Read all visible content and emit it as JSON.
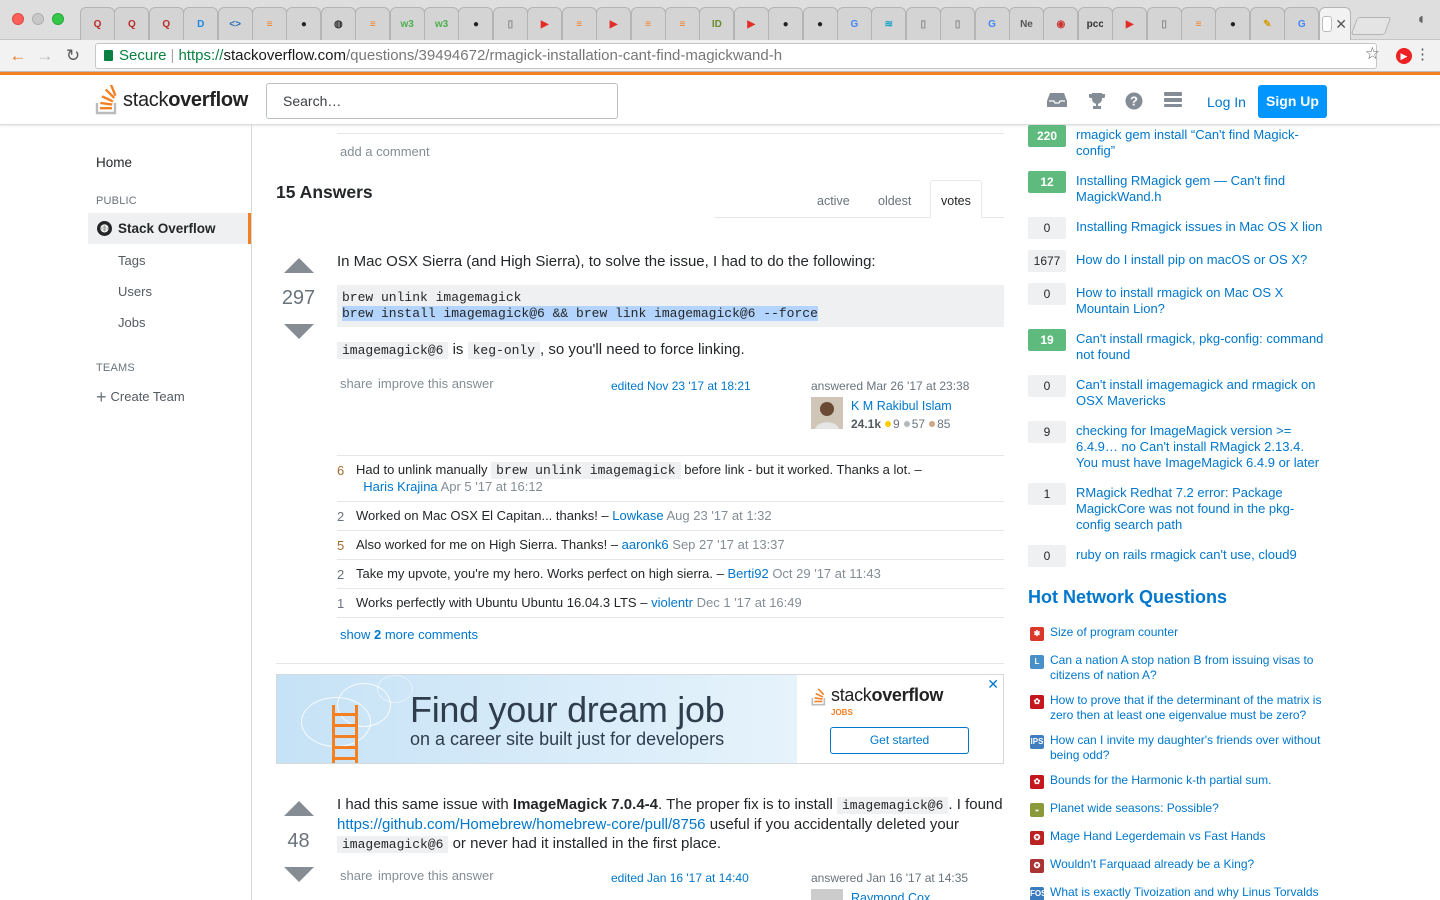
{
  "browser": {
    "tabs": [
      {
        "icon": "quora-icon",
        "glyph": "Q",
        "color": "#b92b27"
      },
      {
        "icon": "quora-icon",
        "glyph": "Q",
        "color": "#b92b27"
      },
      {
        "icon": "quora-icon",
        "glyph": "Q",
        "color": "#b92b27"
      },
      {
        "icon": "d-icon",
        "glyph": "D",
        "color": "#1e88e5"
      },
      {
        "icon": "code-icon",
        "glyph": "<>",
        "color": "#2a6db5"
      },
      {
        "icon": "stackoverflow-icon",
        "glyph": "≡",
        "color": "#f48024"
      },
      {
        "icon": "github-icon",
        "glyph": "●",
        "color": "#222"
      },
      {
        "icon": "globe-icon",
        "glyph": "◍",
        "color": "#333"
      },
      {
        "icon": "stackoverflow-icon",
        "glyph": "≡",
        "color": "#f48024"
      },
      {
        "icon": "w3-icon",
        "glyph": "w3",
        "color": "#4caf50"
      },
      {
        "icon": "w3-icon",
        "glyph": "w3",
        "color": "#4caf50"
      },
      {
        "icon": "github-icon",
        "glyph": "●",
        "color": "#222"
      },
      {
        "icon": "document-icon",
        "glyph": "▯",
        "color": "#888"
      },
      {
        "icon": "youtube-icon",
        "glyph": "▶",
        "color": "#e52d27"
      },
      {
        "icon": "stackoverflow-icon",
        "glyph": "≡",
        "color": "#f48024"
      },
      {
        "icon": "youtube-icon",
        "glyph": "▶",
        "color": "#e52d27"
      },
      {
        "icon": "stackoverflow-icon",
        "glyph": "≡",
        "color": "#f48024"
      },
      {
        "icon": "stackoverflow-icon",
        "glyph": "≡",
        "color": "#f48024"
      },
      {
        "icon": "id-icon",
        "glyph": "ID",
        "color": "#6a8b2f"
      },
      {
        "icon": "youtube-icon",
        "glyph": "▶",
        "color": "#e52d27"
      },
      {
        "icon": "github-icon",
        "glyph": "●",
        "color": "#222"
      },
      {
        "icon": "github-icon",
        "glyph": "●",
        "color": "#222"
      },
      {
        "icon": "google-icon",
        "glyph": "G",
        "color": "#4285f4"
      },
      {
        "icon": "wifi-icon",
        "glyph": "≋",
        "color": "#1aa3c8"
      },
      {
        "icon": "document-icon",
        "glyph": "▯",
        "color": "#888"
      },
      {
        "icon": "document-icon",
        "glyph": "▯",
        "color": "#888"
      },
      {
        "icon": "google-icon",
        "glyph": "G",
        "color": "#4285f4"
      },
      {
        "icon": "ne-icon",
        "glyph": "Ne",
        "color": "#555"
      },
      {
        "icon": "badge-icon",
        "glyph": "◉",
        "color": "#c33"
      },
      {
        "icon": "pcc-icon",
        "glyph": "pcc",
        "color": "#333"
      },
      {
        "icon": "youtube-icon",
        "glyph": "▶",
        "color": "#e52d27"
      },
      {
        "icon": "document-icon",
        "glyph": "▯",
        "color": "#888"
      },
      {
        "icon": "stackoverflow-icon",
        "glyph": "≡",
        "color": "#f48024"
      },
      {
        "icon": "github-icon",
        "glyph": "●",
        "color": "#222"
      },
      {
        "icon": "pencil-icon",
        "glyph": "✎",
        "color": "#d4a017"
      },
      {
        "icon": "google-icon",
        "glyph": "G",
        "color": "#4285f4"
      }
    ],
    "active_tab_close": "✕",
    "secure_label": "Secure",
    "url_https": "https://",
    "url_host": "stackoverflow.com",
    "url_path": "/questions/39494672/rmagick-installation-cant-find-magickwand-h"
  },
  "site": {
    "logo_stack": "stack",
    "logo_overflow": "overflow",
    "search_placeholder": "Search…",
    "login": "Log In",
    "signup": "Sign Up"
  },
  "nav": {
    "home": "Home",
    "public": "PUBLIC",
    "stackoverflow": "Stack Overflow",
    "tags": "Tags",
    "users": "Users",
    "jobs": "Jobs",
    "teams": "TEAMS",
    "create_team": "Create Team"
  },
  "question": {
    "add_comment": "add a comment",
    "answers_count": "15 Answers",
    "sort": {
      "active": "active",
      "oldest": "oldest",
      "votes": "votes"
    }
  },
  "answer1": {
    "votes": "297",
    "intro": "In Mac OSX Sierra (and High Sierra), to solve the issue, I had to do the following:",
    "code_line1": "brew unlink imagemagick",
    "code_line2": "brew install imagemagick@6 && brew link imagemagick@6 --force",
    "note_code1": "imagemagick@6",
    "note_is": "is",
    "note_code2": "keg-only",
    "note_rest": ", so you'll need to force linking.",
    "share": "share",
    "improve": "improve this answer",
    "edited": "edited Nov 23 '17 at 18:21",
    "answered": "answered Mar 26 '17 at 23:38",
    "user": "K M Rakibul Islam",
    "rep": "24.1k",
    "gold": "9",
    "silver": "57",
    "bronze": "85",
    "comments": [
      {
        "score": "6",
        "hot": true,
        "text_before": "Had to unlink manually",
        "code": "brew unlink imagemagick",
        "text_after": "before link - but it worked. Thanks a lot. –",
        "user": "Haris Krajina",
        "date": "Apr 5 '17 at 16:12"
      },
      {
        "score": "2",
        "hot": false,
        "text_before": "Worked on Mac OSX El Capitan... thanks! –",
        "code": "",
        "text_after": "",
        "user": "Lowkase",
        "date": "Aug 23 '17 at 1:32"
      },
      {
        "score": "5",
        "hot": true,
        "text_before": "Also worked for me on High Sierra. Thanks! –",
        "code": "",
        "text_after": "",
        "user": "aaronk6",
        "date": "Sep 27 '17 at 13:37"
      },
      {
        "score": "2",
        "hot": false,
        "text_before": "Take my upvote, you're my hero. Works perfect on high sierra. –",
        "code": "",
        "text_after": "",
        "user": "Berti92",
        "date": "Oct 29 '17 at 11:43"
      },
      {
        "score": "1",
        "hot": false,
        "text_before": "Works perfectly with Ubuntu Ubuntu 16.04.3 LTS –",
        "code": "",
        "text_after": "",
        "user": "violentr",
        "date": "Dec 1 '17 at 16:49"
      }
    ],
    "show_more_prefix": "show",
    "show_more_count": "2",
    "show_more_suffix": "more comments"
  },
  "ad": {
    "title": "Find your dream job",
    "subtitle": "on a career site built just for developers",
    "logo_stack": "stack",
    "logo_overflow": "overflow",
    "jobs": "JOBS",
    "button": "Get started",
    "close": "✕"
  },
  "answer2": {
    "votes": "48",
    "p1": "I had this same issue with",
    "p1_bold": "ImageMagick 7.0.4-4",
    "p1_rest": ". The proper fix is to install",
    "p1_code": "imagemagick@6",
    "p1_end": ". I found",
    "link": "https://github.com/Homebrew/homebrew-core/pull/8756",
    "p2": "useful if you accidentally deleted your",
    "p2_code": "imagemagick@6",
    "p2_end": "or never had it installed in the first place.",
    "share": "share",
    "improve": "improve this answer",
    "edited": "edited Jan 16 '17 at 14:40",
    "answered": "answered Jan 16 '17 at 14:35",
    "user": "Raymond Cox"
  },
  "related": [
    {
      "score": "220",
      "accepted": true,
      "title": "rmagick gem install “Can't find Magick-config”"
    },
    {
      "score": "12",
      "accepted": true,
      "title": "Installing RMagick gem — Can't find MagickWand.h"
    },
    {
      "score": "0",
      "accepted": false,
      "title": "Installing Rmagick issues in Mac OS X lion"
    },
    {
      "score": "1677",
      "accepted": false,
      "title": "How do I install pip on macOS or OS X?"
    },
    {
      "score": "0",
      "accepted": false,
      "title": "How to install rmagick on Mac OS X Mountain Lion?"
    },
    {
      "score": "19",
      "accepted": true,
      "title": "Can't install rmagick, pkg-config: command not found"
    },
    {
      "score": "0",
      "accepted": false,
      "title": "Can't install imagemagick and rmagick on OSX Mavericks"
    },
    {
      "score": "9",
      "accepted": false,
      "title": "checking for ImageMagick version >= 6.4.9… no Can't install RMagick 2.13.4. You must have ImageMagick 6.4.9 or later"
    },
    {
      "score": "1",
      "accepted": false,
      "title": "RMagick Redhat 7.2 error: Package MagickCore was not found in the pkg-config search path"
    },
    {
      "score": "0",
      "accepted": false,
      "title": "ruby on rails rmagick can't use, cloud9"
    }
  ],
  "hnq": {
    "heading": "Hot Network Questions",
    "items": [
      {
        "icon": "electronics-icon",
        "color": "#d9382b",
        "glyph": "✱",
        "title": "Size of program counter"
      },
      {
        "icon": "law-icon",
        "color": "#4a90c8",
        "glyph": "L",
        "title": "Can a nation A stop nation B from issuing visas to citizens of nation A?"
      },
      {
        "icon": "math-icon",
        "color": "#c4161c",
        "glyph": "✿",
        "title": "How to prove that if the determinant of the matrix is zero then at least one eigenvalue must be zero?"
      },
      {
        "icon": "ips-icon",
        "color": "#3f7fc1",
        "glyph": "IPS",
        "title": "How can I invite my daughter's friends over without being odd?"
      },
      {
        "icon": "math-icon",
        "color": "#c4161c",
        "glyph": "✿",
        "title": "Bounds for the Harmonic k-th partial sum."
      },
      {
        "icon": "worldbuilding-icon",
        "color": "#8a9a3a",
        "glyph": "◒",
        "title": "Planet wide seasons: Possible?"
      },
      {
        "icon": "rpg-icon",
        "color": "#b22",
        "glyph": "✪",
        "title": "Mage Hand Legerdemain vs Fast Hands"
      },
      {
        "icon": "scifi-icon",
        "color": "#a33",
        "glyph": "✪",
        "title": "Wouldn't Farquaad already be a King?"
      },
      {
        "icon": "foss-icon",
        "color": "#3a7bbf",
        "glyph": "FOS",
        "title": "What is exactly Tivoization and why Linus Torvalds"
      }
    ]
  }
}
